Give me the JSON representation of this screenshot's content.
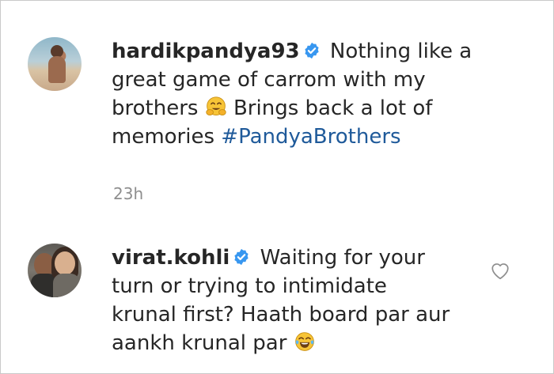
{
  "comments": [
    {
      "username": "hardikpandya93",
      "text_1": "Nothing like a great game of carrom with my brothers",
      "text_2": "Brings back a lot of memories",
      "hashtag": "#PandyaBrothers",
      "emoji": "hugging-face-emoji",
      "timestamp": "23h"
    },
    {
      "username": "virat.kohli",
      "text_1": "Waiting for your turn or trying to intimidate krunal first? Haath board par aur aankh krunal par",
      "emoji": "tears-of-joy-emoji"
    }
  ],
  "icons": {
    "verified": "verified-badge-icon",
    "like": "heart-outline-icon"
  },
  "colors": {
    "text": "#262626",
    "muted": "#8e8e8e",
    "hashtag": "#1f5a9a",
    "verified": "#3897f0"
  }
}
